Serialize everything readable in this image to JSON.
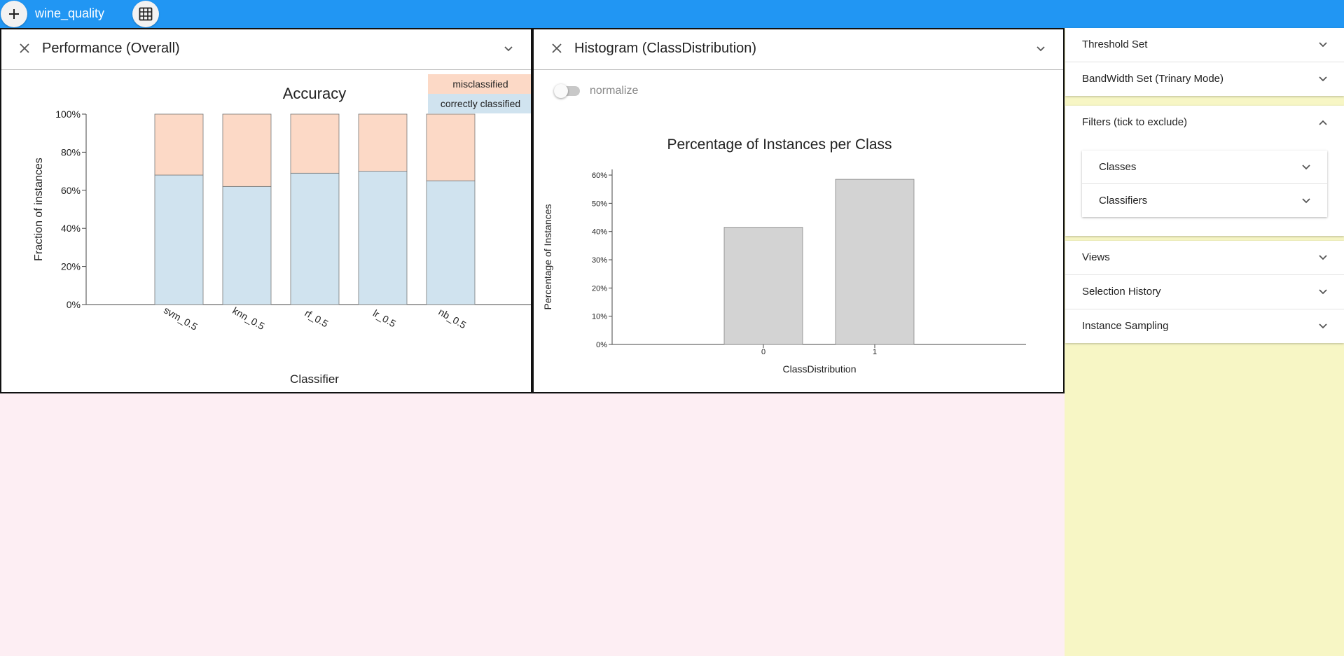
{
  "app": {
    "title": "wine_quality",
    "add_icon": "plus-icon",
    "grid_icon": "grid-icon"
  },
  "colors": {
    "topbar": "#2196f3",
    "misclassified": "#fcd9c6",
    "correct": "#d0e3ef",
    "histogram_bar": "#d3d3d3",
    "sidebar_bg": "#f7f6c5",
    "workspace_bg": "#fdeef3"
  },
  "panels": {
    "performance": {
      "title": "Performance (Overall)",
      "legend": {
        "misclassified": "misclassified",
        "correct": "correctly classified"
      }
    },
    "histogram": {
      "title": "Histogram (ClassDistribution)",
      "normalize_label": "normalize",
      "normalize_on": false
    }
  },
  "chart_data": [
    {
      "type": "bar",
      "title": "Accuracy",
      "xlabel": "Classifier",
      "ylabel": "Fraction of instances",
      "categories": [
        "svm_0.5",
        "knn_0.5",
        "rf_0.5",
        "lr_0.5",
        "nb_0.5"
      ],
      "series": [
        {
          "name": "correctly classified",
          "values": [
            0.68,
            0.62,
            0.69,
            0.7,
            0.65
          ]
        },
        {
          "name": "misclassified",
          "values": [
            0.32,
            0.38,
            0.31,
            0.3,
            0.35
          ]
        }
      ],
      "stacked": true,
      "ylim": [
        0,
        1
      ],
      "yticks": [
        "0%",
        "20%",
        "40%",
        "60%",
        "80%",
        "100%"
      ],
      "legend": "top-right"
    },
    {
      "type": "bar",
      "title": "Percentage of Instances per Class",
      "xlabel": "ClassDistribution",
      "ylabel": "Percentage of Instances",
      "categories": [
        "0",
        "1"
      ],
      "values": [
        41.5,
        58.5
      ],
      "ylim": [
        0,
        62
      ],
      "yticks": [
        "0%",
        "10%",
        "20%",
        "30%",
        "40%",
        "50%",
        "60%"
      ]
    }
  ],
  "sidebar": {
    "threshold": "Threshold Set",
    "bandwidth": "BandWidth Set (Trinary Mode)",
    "filters": "Filters (tick to exclude)",
    "classes": "Classes",
    "classifiers": "Classifiers",
    "views": "Views",
    "history": "Selection History",
    "sampling": "Instance Sampling"
  }
}
